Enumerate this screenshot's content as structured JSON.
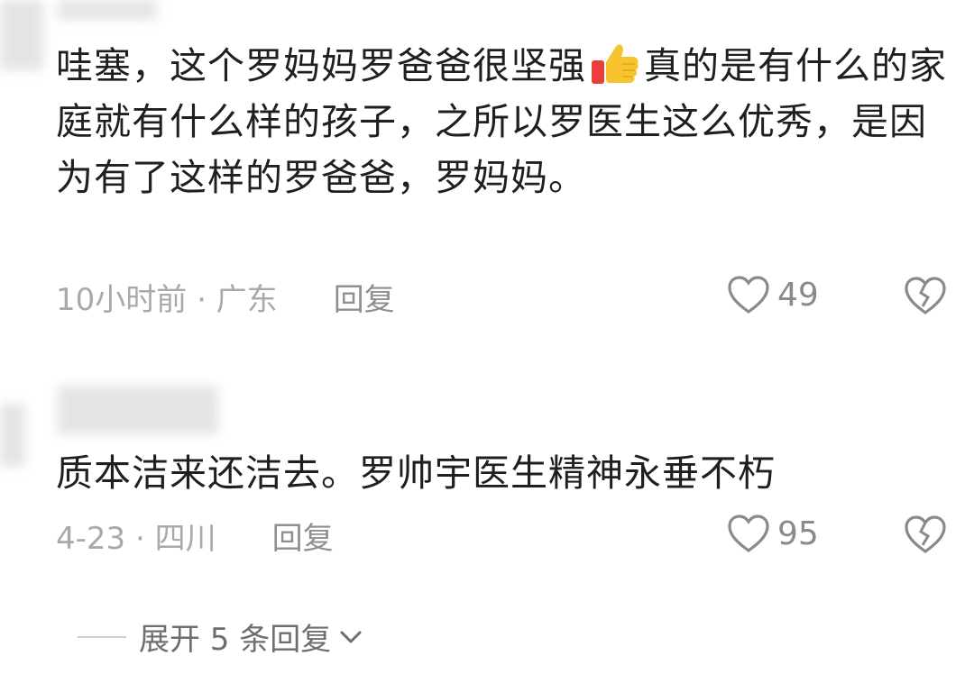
{
  "comments": [
    {
      "text_before_emoji": "哇塞，这个罗妈妈罗爸爸很坚强",
      "emoji_icon": "thumbs-up-icon",
      "text_after_emoji": "真的是有什么的家庭就有什么样的孩子，之所以罗医生这么优秀，是因为有了这样的罗爸爸，罗妈妈。",
      "meta": "10小时前 · 广东",
      "reply_label": "回复",
      "likes": "49"
    },
    {
      "text": "质本洁来还洁去。罗帅宇医生精神永垂不朽",
      "meta": "4-23 · 四川",
      "reply_label": "回复",
      "likes": "95"
    }
  ],
  "expand_label": "展开 5 条回复",
  "icons": {
    "like": "heart-outline-icon",
    "dislike": "broken-heart-icon",
    "expand": "chevron-down-icon"
  },
  "colors": {
    "text": "#1f1f1f",
    "meta": "#a9a9a9",
    "icon": "#8a8a8a"
  }
}
